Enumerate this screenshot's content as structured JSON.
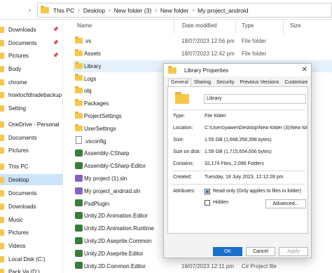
{
  "address": {
    "crumbs": [
      "This PC",
      "Desktop",
      "New folder (3)",
      "New folder",
      "My project_android"
    ]
  },
  "sidebar": {
    "items": [
      {
        "label": "Downloads",
        "pinned": true,
        "icon": "download-icon"
      },
      {
        "label": "Documents",
        "pinned": true,
        "icon": "document-icon"
      },
      {
        "label": "Pictures",
        "pinned": true,
        "icon": "picture-icon"
      },
      {
        "label": "Body",
        "pinned": false,
        "icon": "folder-icon"
      },
      {
        "label": "chrome",
        "pinned": false,
        "icon": "folder-icon"
      },
      {
        "label": "howtocfdtradebackup",
        "pinned": false,
        "icon": "folder-icon"
      },
      {
        "label": "Setting",
        "pinned": false,
        "icon": "folder-icon"
      },
      {
        "label": "OneDrive - Personal",
        "pinned": false,
        "icon": "cloud-icon"
      },
      {
        "label": "Documents",
        "pinned": false,
        "icon": "folder-icon"
      },
      {
        "label": "Pictures",
        "pinned": false,
        "icon": "folder-icon"
      },
      {
        "label": "This PC",
        "pinned": false,
        "icon": "pc-icon"
      },
      {
        "label": "Desktop",
        "pinned": false,
        "icon": "desktop-icon",
        "selected": true
      },
      {
        "label": "Documents",
        "pinned": false,
        "icon": "document-icon"
      },
      {
        "label": "Downloads",
        "pinned": false,
        "icon": "download-icon"
      },
      {
        "label": "Music",
        "pinned": false,
        "icon": "music-icon"
      },
      {
        "label": "Pictures",
        "pinned": false,
        "icon": "picture-icon"
      },
      {
        "label": "Videos",
        "pinned": false,
        "icon": "video-icon"
      },
      {
        "label": "Local Disk (C:)",
        "pinned": false,
        "icon": "drive-icon"
      },
      {
        "label": "Pack Va (D:)",
        "pinned": false,
        "icon": "drive-icon"
      }
    ]
  },
  "columns": {
    "name": "Name",
    "date": "Date modified",
    "type": "Type",
    "size": "Size"
  },
  "files": [
    {
      "name": ".vs",
      "date": "18/07/2023 12:56 pm",
      "type": "File folder",
      "icon": "folder"
    },
    {
      "name": "Assets",
      "date": "18/07/2023 12:42 pm",
      "type": "File folder",
      "icon": "folder"
    },
    {
      "name": "Library",
      "date": "",
      "type": "",
      "icon": "folder",
      "selected": true
    },
    {
      "name": "Logs",
      "date": "",
      "type": "",
      "icon": "folder"
    },
    {
      "name": "obj",
      "date": "",
      "type": "",
      "icon": "folder"
    },
    {
      "name": "Packages",
      "date": "",
      "type": "",
      "icon": "folder"
    },
    {
      "name": "ProjectSettings",
      "date": "",
      "type": "",
      "icon": "folder"
    },
    {
      "name": "UserSettings",
      "date": "",
      "type": "",
      "icon": "folder"
    },
    {
      "name": ".vsconfig",
      "date": "",
      "type": "",
      "icon": "doc"
    },
    {
      "name": "Assembly-CSharp",
      "date": "",
      "type": "",
      "icon": "cs"
    },
    {
      "name": "Assembly-CSharp-Editor",
      "date": "",
      "type": "",
      "icon": "cs"
    },
    {
      "name": "My project (1).sln",
      "date": "",
      "type": "",
      "icon": "sln"
    },
    {
      "name": "My project_android.sln",
      "date": "",
      "type": "",
      "icon": "sln"
    },
    {
      "name": "PsdPlugin",
      "date": "",
      "type": "",
      "icon": "cs"
    },
    {
      "name": "Unity.2D.Animation.Editor",
      "date": "",
      "type": "",
      "icon": "cs"
    },
    {
      "name": "Unity.2D.Animation.Runtime",
      "date": "",
      "type": "",
      "icon": "cs"
    },
    {
      "name": "Unity.2D.Aseprite.Common",
      "date": "",
      "type": "",
      "icon": "cs"
    },
    {
      "name": "Unity.2D.Aseprite.Editor",
      "date": "",
      "type": "",
      "icon": "cs"
    },
    {
      "name": "Unity.2D.Common.Editor",
      "date": "18/07/2023 12:11 pm",
      "type": "C# Project file",
      "icon": "cs"
    }
  ],
  "dialog": {
    "title": "Library Properties",
    "close": "✕",
    "tabs": [
      "General",
      "Sharing",
      "Security",
      "Previous Versions",
      "Customize"
    ],
    "active_tab": "General",
    "name_value": "Library",
    "labels": {
      "type": "Type:",
      "location": "Location:",
      "size": "Size:",
      "size_on_disk": "Size on disk:",
      "contains": "Contains:",
      "created": "Created:",
      "attributes": "Attributes:"
    },
    "values": {
      "type": "File folder",
      "location": "C:\\Users\\yawer\\Desktop\\New folder (3)\\New folder",
      "size": "1.55 GB (1,668,358,398 bytes)",
      "size_on_disk": "1.59 GB (1,715,654,656 bytes)",
      "contains": "32,174 Files, 2,096 Folders",
      "created": "Tuesday, 18 July 2023, 12:12:28 pm"
    },
    "readonly_label": "Read-only (Only applies to files in folder)",
    "hidden_label": "Hidden",
    "advanced_label": "Advanced...",
    "ok_label": "OK",
    "cancel_label": "Cancel",
    "apply_label": "Apply"
  }
}
